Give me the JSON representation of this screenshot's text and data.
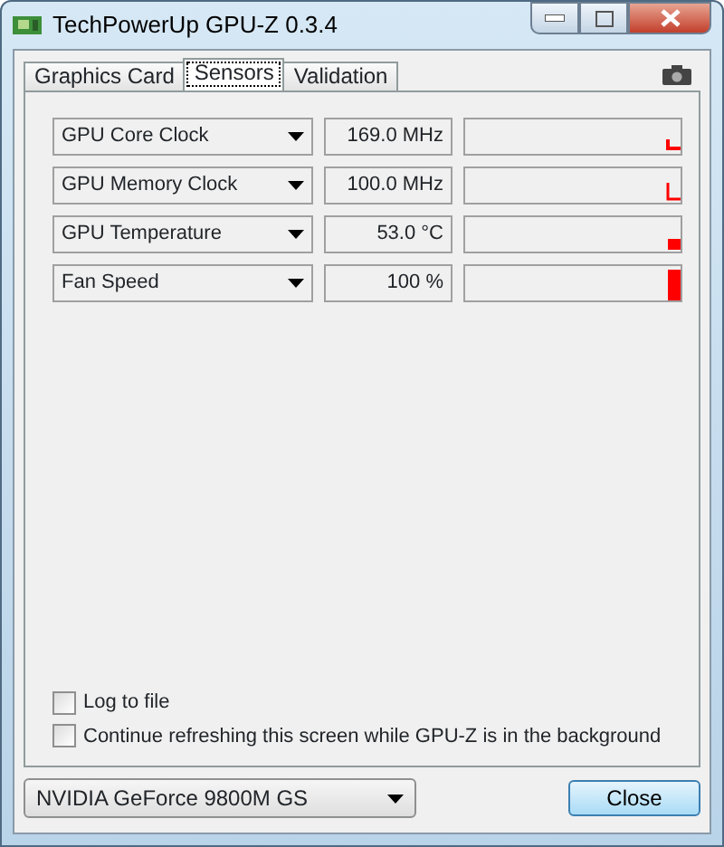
{
  "window": {
    "title": "TechPowerUp GPU-Z 0.3.4"
  },
  "tabs": [
    {
      "label": "Graphics Card",
      "selected": false
    },
    {
      "label": "Sensors",
      "selected": true
    },
    {
      "label": "Validation",
      "selected": false
    }
  ],
  "sensors": [
    {
      "name": "GPU Core Clock",
      "reading": "169.0 MHz"
    },
    {
      "name": "GPU Memory Clock",
      "reading": "100.0 MHz"
    },
    {
      "name": "GPU Temperature",
      "reading": "53.0 °C"
    },
    {
      "name": "Fan Speed",
      "reading": "100 %"
    }
  ],
  "options": [
    {
      "label": "Log to file",
      "checked": false
    },
    {
      "label": "Continue refreshing this screen while GPU-Z is in the background",
      "checked": false
    }
  ],
  "gpu_select": {
    "value": "NVIDIA GeForce 9800M GS"
  },
  "buttons": [
    {
      "label": "Close"
    }
  ]
}
